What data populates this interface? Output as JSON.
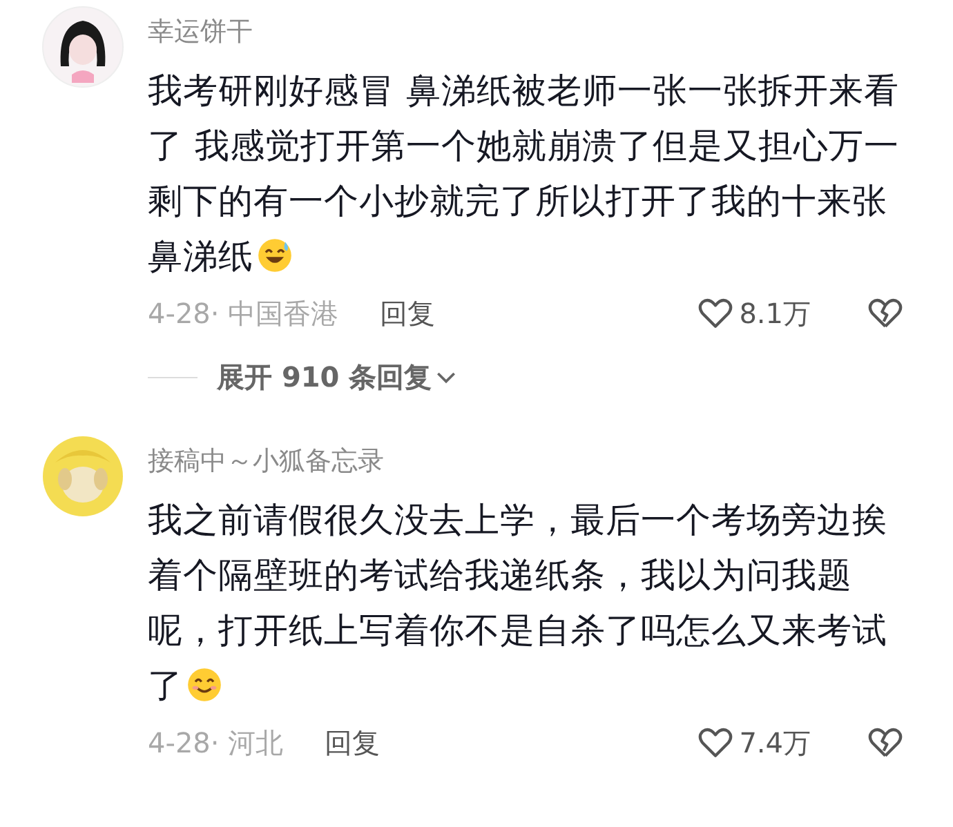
{
  "comments": [
    {
      "kind": "comment",
      "avatar": {
        "kind": "girl"
      },
      "username": "幸运饼干",
      "text": "我考研刚好感冒 鼻涕纸被老师一张一张拆开来看了 我感觉打开第一个她就崩溃了但是又担心万一剩下的有一个小抄就完了所以打开了我的十来张鼻涕纸",
      "emoji": {
        "kind": "sweat-smile"
      },
      "meta": "4-28· 中国香港",
      "reply": "回复",
      "likes": "8.1万"
    },
    {
      "kind": "expand",
      "label": "展开 910 条回复"
    },
    {
      "kind": "comment",
      "avatar": {
        "kind": "dog"
      },
      "username": "接稿中～小狐备忘录",
      "text": "我之前请假很久没去上学，最后一个考场旁边挨着个隔壁班的考试给我递纸条，我以为问我题呢，打开纸上写着你不是自杀了吗怎么又来考试了",
      "emoji": {
        "kind": "smile"
      },
      "meta": "4-28· 河北",
      "reply": "回复",
      "likes": "7.4万"
    }
  ]
}
